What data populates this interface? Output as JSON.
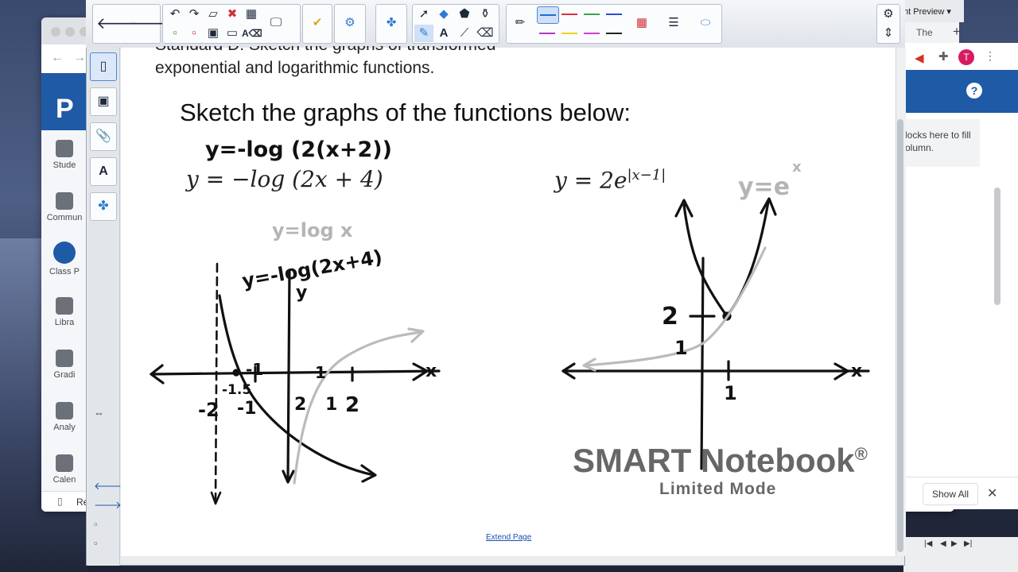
{
  "background_browser": {
    "sidebar_items": [
      {
        "label": "Stude"
      },
      {
        "label": "Commun"
      },
      {
        "label": "Class P"
      },
      {
        "label": "Libra"
      },
      {
        "label": "Gradi"
      },
      {
        "label": "Analy"
      },
      {
        "label": "Calen"
      }
    ],
    "bottom_item": "Re"
  },
  "right_window": {
    "tab_title": "nt Preview",
    "second_tab": "The",
    "avatar_initial": "T",
    "help_label": "?",
    "hint_line1": "locks here to fill",
    "hint_line2": "olumn.",
    "show_all_label": "Show All"
  },
  "smart_toolbar": {
    "pen_colors": [
      "#1a6fd6",
      "#d6333a",
      "#3aa24a",
      "#2d4bd3",
      "#b236c9",
      "#e9d51a",
      "#d13fd1",
      "#222222"
    ]
  },
  "page": {
    "standard_line1": "Standard D: Sketch the graphs of transformed",
    "standard_line2": "exponential and logarithmic functions.",
    "heading": "Sketch the graphs of the functions below:",
    "function1": "y = −log (2x + 4)",
    "function2_base": "y = 2e",
    "function2_exp": "|x−1|",
    "extend_link": "Extend Page"
  },
  "handwriting": {
    "note1": "y=-log (2(x+2))",
    "note_gray1": "y=log x",
    "note2": "y=-log(2x+4)",
    "note_gray2": "y=e",
    "note_gray2_exp": "x",
    "y_label": "y",
    "x_label": "x",
    "tick_neg2": "-2",
    "tick_neg1_top": "-1",
    "tick_neg15": "-1.5",
    "tick_neg1_bottom": "-1",
    "tick_half_top": "1",
    "tick_half_bottom": "2",
    "tick_1": "1",
    "tick_2": "2",
    "graph2_y2": "2",
    "graph2_y1": "1",
    "graph2_x1": "1"
  },
  "watermark": {
    "title": "SMART Notebook",
    "reg": "®",
    "mode": "Limited Mode"
  }
}
